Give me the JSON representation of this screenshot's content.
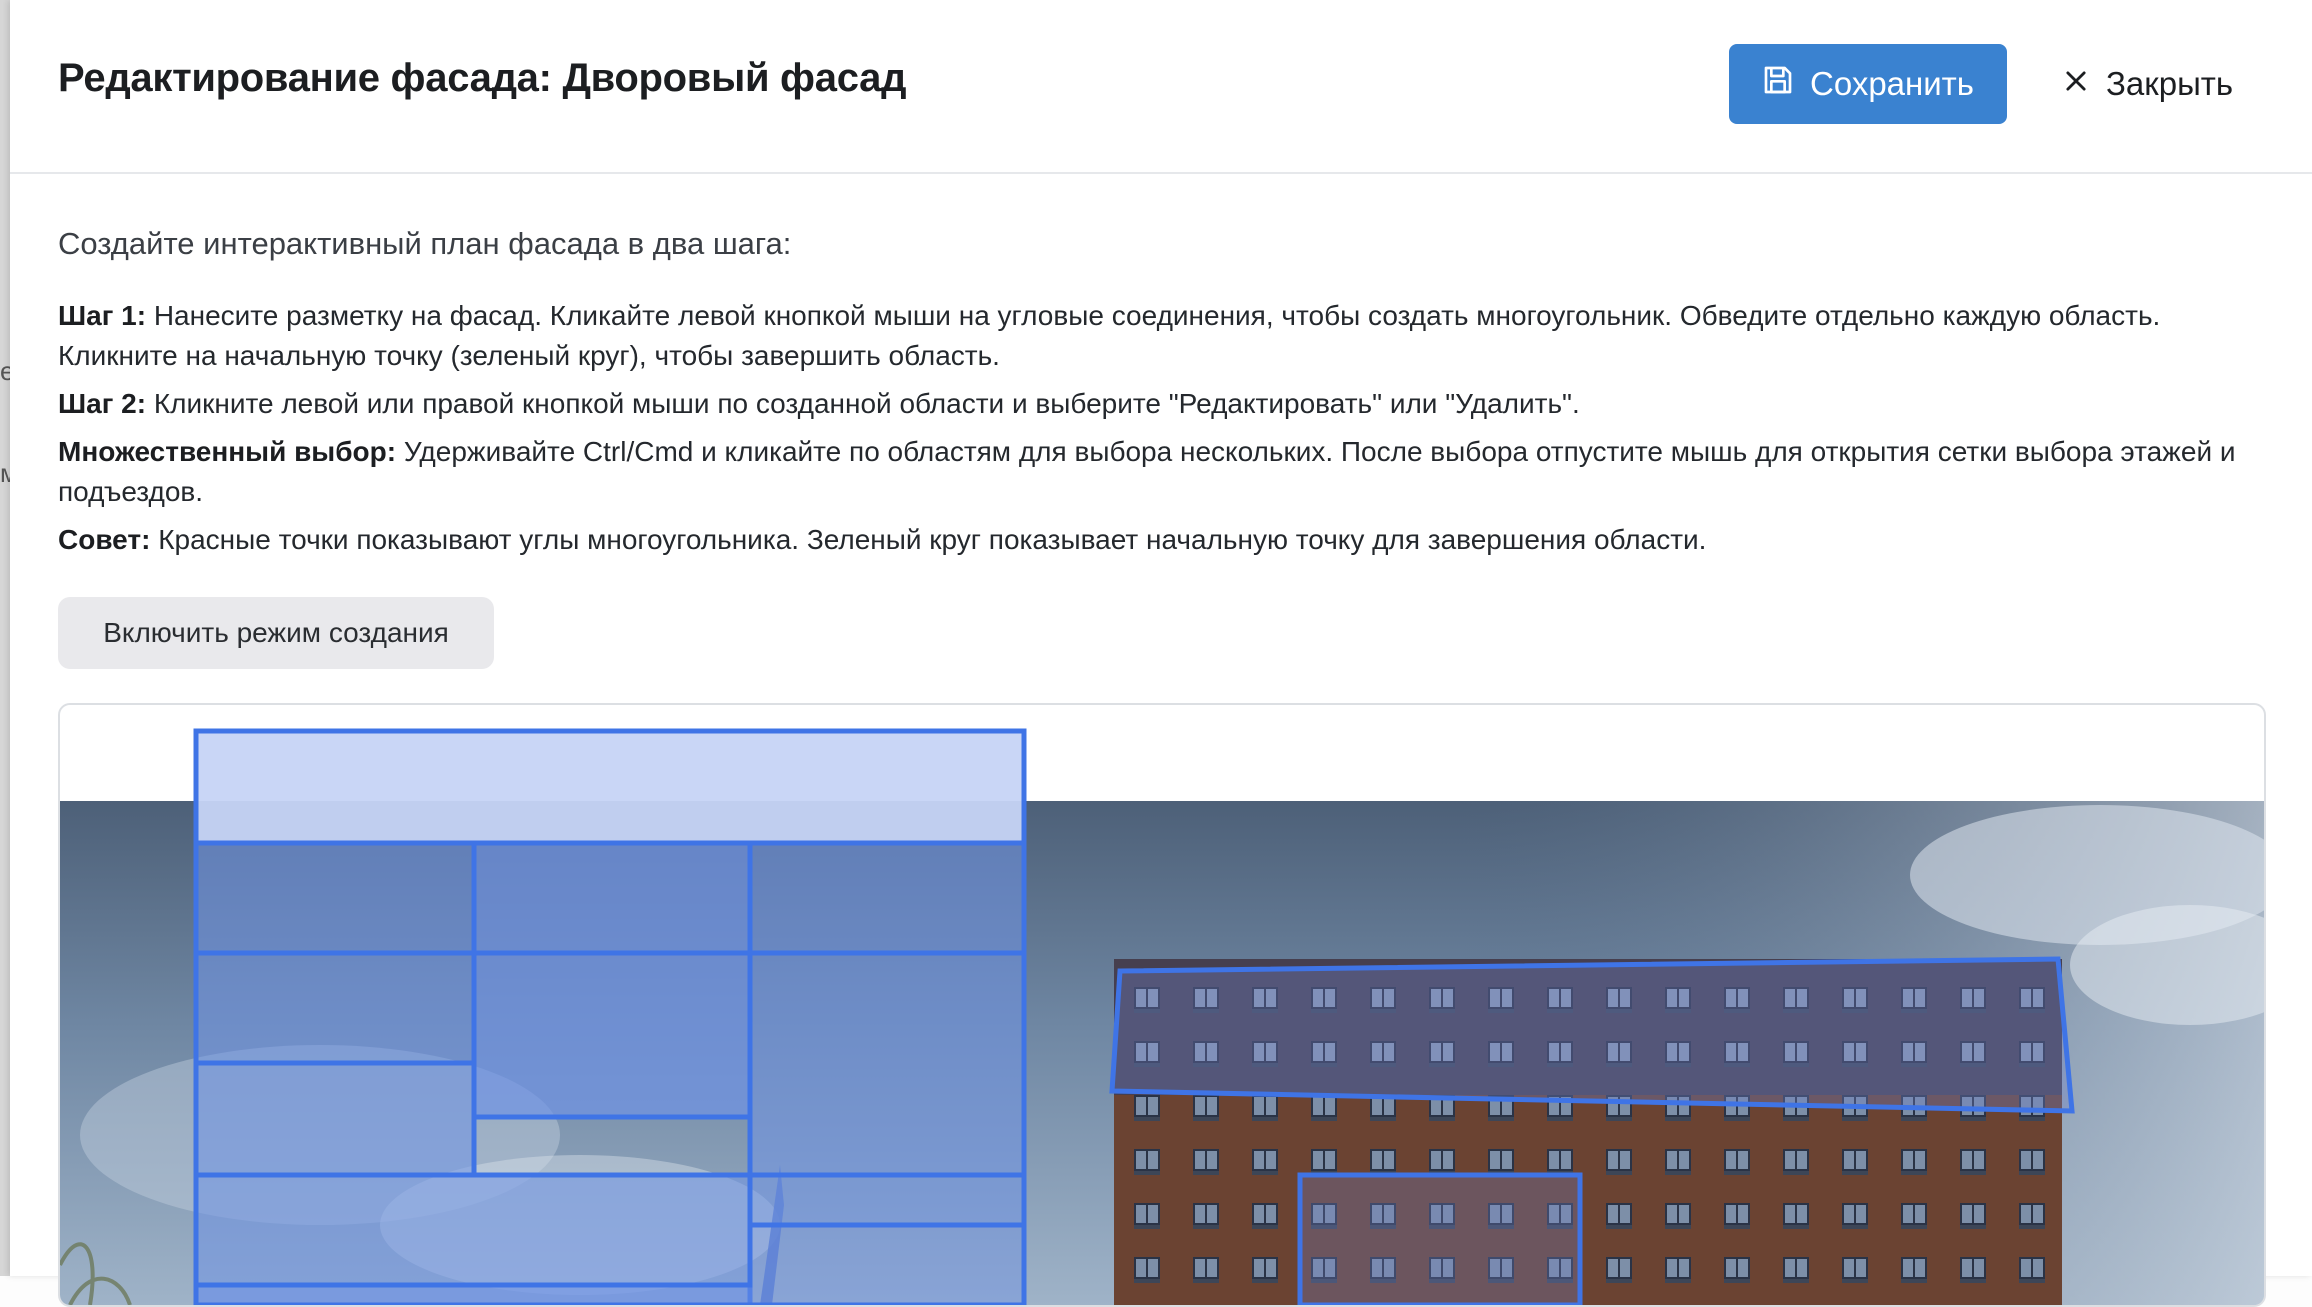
{
  "backdrop": {
    "edge_glyphs": [
      "е",
      "м"
    ]
  },
  "header": {
    "title": "Редактирование фасада: Дворовый фасад",
    "save_label": "Сохранить",
    "close_label": "Закрыть",
    "save_icon": "save-icon",
    "close_icon": "close-icon"
  },
  "instructions": {
    "intro": "Создайте интерактивный план фасада в два шага:",
    "steps": [
      {
        "label": "Шаг 1:",
        "text": " Нанесите разметку на фасад. Кликайте левой кнопкой мыши на угловые соединения, чтобы создать многоугольник. Обведите отдельно каждую область. Кликните на начальную точку (зеленый круг), чтобы завершить область."
      },
      {
        "label": "Шаг 2:",
        "text": " Кликните левой или правой кнопкой мыши по созданной области и выберите \"Редактировать\" или \"Удалить\"."
      },
      {
        "label": "Множественный выбор:",
        "text": " Удерживайте Ctrl/Cmd и кликайте по областям для выбора нескольких. После выбора отпустите мышь для открытия сетки выбора этажей и подъездов."
      },
      {
        "label": "Совет:",
        "text": " Красные точки показывают углы многоугольника. Зеленый круг показывает начальную точку для завершения области."
      }
    ]
  },
  "mode_button": {
    "label": "Включить режим создания"
  },
  "colors": {
    "accent": "#3a82d0",
    "polygon_stroke": "#3f74e6",
    "polygon_fill": "#6f93e6",
    "sky_top": "#4a5e77",
    "brick": "#6b4332"
  }
}
